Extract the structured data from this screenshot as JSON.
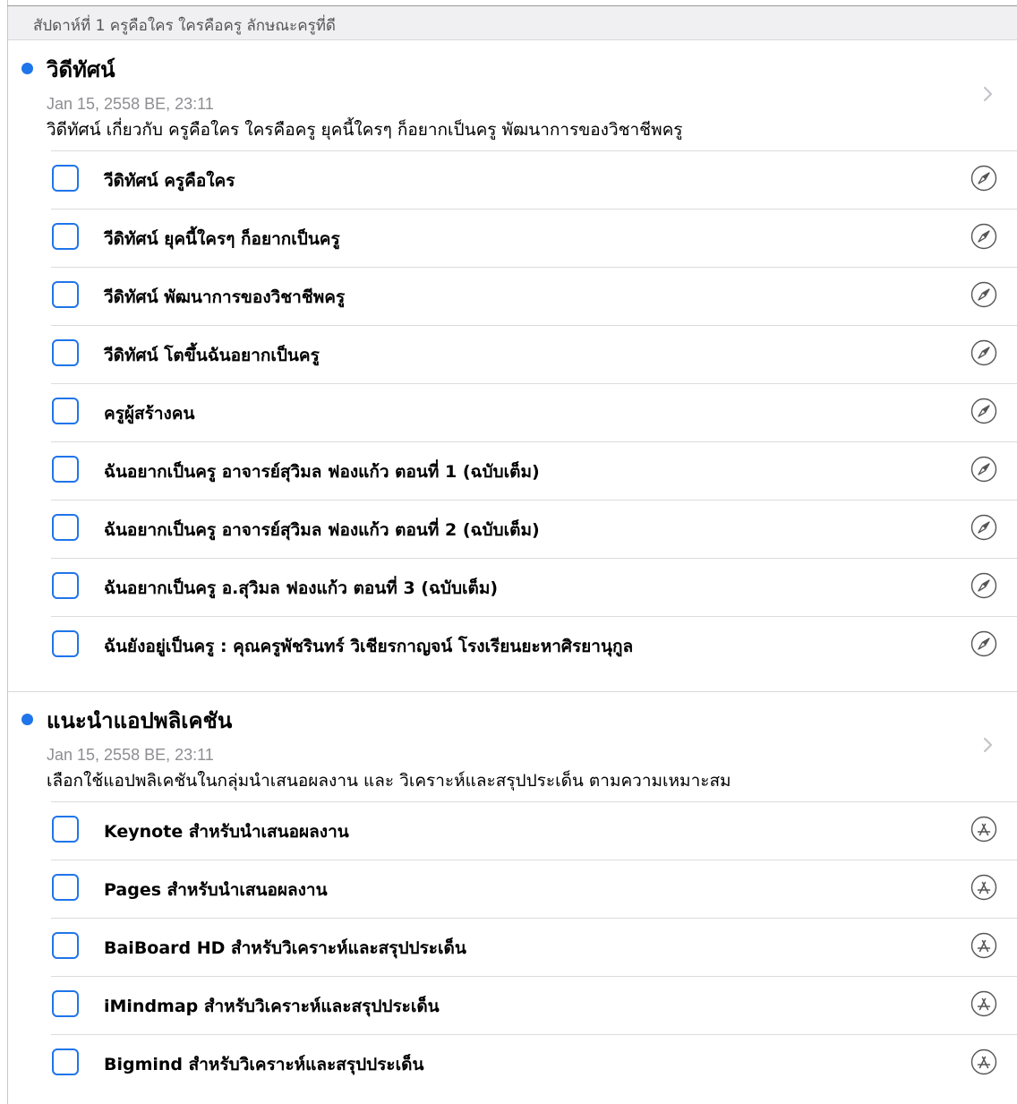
{
  "header": {
    "title": "สัปดาห์ที่ 1 ครูคือใคร  ใครคือครู  ลักษณะครูที่ดี"
  },
  "colors": {
    "accent": "#1f75ea",
    "separator": "#dcdcdf",
    "secondary_text": "#8e8e93"
  },
  "sections": [
    {
      "title": "วิดีทัศน์",
      "date": "Jan 15, 2558 BE, 23:11",
      "description": "วิดีทัศน์ เกี่ยวกับ ครูคือใคร ใครคือครู ยุคนี้ใครๆ ก็อยากเป็นครู พัฒนาการของวิชาชีพครู",
      "item_icon": "safari-compass-icon",
      "items": [
        {
          "label": "วีดิทัศน์ ครูคือใคร"
        },
        {
          "label": "วีดิทัศน์ ยุคนี้ใครๆ ก็อยากเป็นครู"
        },
        {
          "label": "วีดิทัศน์ พัฒนาการของวิชาชีพครู"
        },
        {
          "label": "วีดิทัศน์ โตขึ้นฉันอยากเป็นครู"
        },
        {
          "label": "ครูผู้สร้างคน"
        },
        {
          "label": "ฉันอยากเป็นครู อาจารย์สุวิมล ฟองแก้ว ตอนที่ 1 (ฉบับเต็ม)"
        },
        {
          "label": "ฉันอยากเป็นครู อาจารย์สุวิมล ฟองแก้ว ตอนที่ 2 (ฉบับเต็ม)"
        },
        {
          "label": "ฉันอยากเป็นครู อ.สุวิมล ฟองแก้ว ตอนที่ 3 (ฉบับเต็ม)"
        },
        {
          "label": "ฉันยังอยู่เป็นครู : คุณครูพัชรินทร์ วิเชียรกาญจน์ โรงเรียนยะหาศิรยานุกูล"
        }
      ]
    },
    {
      "title": "แนะนำแอปพลิเคชัน",
      "date": "Jan 15, 2558 BE, 23:11",
      "description": "เลือกใช้แอปพลิเคชันในกลุ่มนำเสนอผลงาน และ วิเคราะห์และสรุปประเด็น ตามความเหมาะสม",
      "item_icon": "app-store-icon",
      "items": [
        {
          "label": "Keynote สำหรับนำเสนอผลงาน"
        },
        {
          "label": "Pages  สำหรับนำเสนอผลงาน"
        },
        {
          "label": "BaiBoard HD สำหรับวิเคราะห์และสรุปประเด็น"
        },
        {
          "label": "iMindmap สำหรับวิเคราะห์และสรุปประเด็น"
        },
        {
          "label": "Bigmind สำหรับวิเคราะห์และสรุปประเด็น"
        }
      ]
    }
  ]
}
